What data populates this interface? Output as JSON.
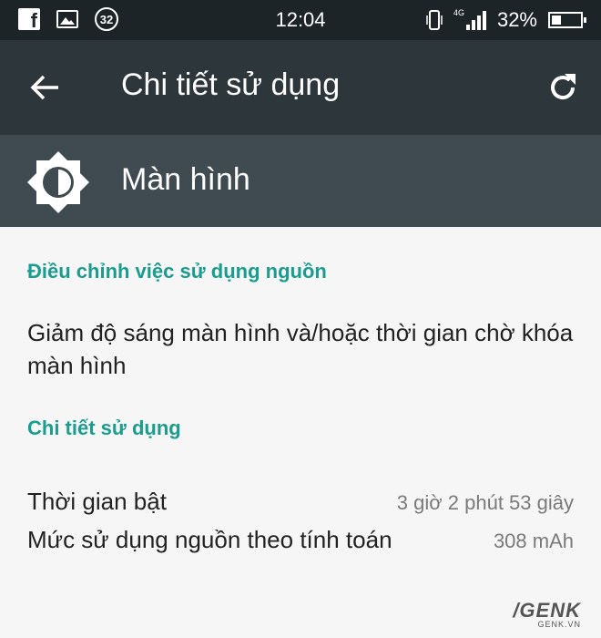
{
  "status_bar": {
    "notification_badge": "32",
    "time": "12:04",
    "network_type": "4G",
    "battery_percent": "32%",
    "battery_level": 0.32,
    "icons": [
      "facebook-icon",
      "image-icon",
      "vibrate-icon",
      "signal-icon",
      "battery-icon"
    ]
  },
  "app_bar": {
    "title": "Chi tiết sử dụng",
    "icons": [
      "back-arrow-icon",
      "refresh-icon"
    ]
  },
  "header": {
    "title": "Màn hình",
    "icon": "brightness-icon"
  },
  "sections": {
    "adjust": {
      "title": "Điều chỉnh việc sử dụng nguồn",
      "description": "Giảm độ sáng màn hình và/hoặc thời gian chờ khóa màn hình"
    },
    "details": {
      "title": "Chi tiết sử dụng",
      "rows": [
        {
          "label": "Thời gian bật",
          "value": "3 giờ 2 phút 53 giây"
        },
        {
          "label": "Mức sử dụng nguồn theo tính toán",
          "value": "308 mAh"
        }
      ]
    }
  },
  "colors": {
    "status_bar": "#1c2428",
    "app_bar": "#2c363b",
    "header": "#3f4b51",
    "accent": "#1a9c8e",
    "background": "#f6f6f6"
  }
}
